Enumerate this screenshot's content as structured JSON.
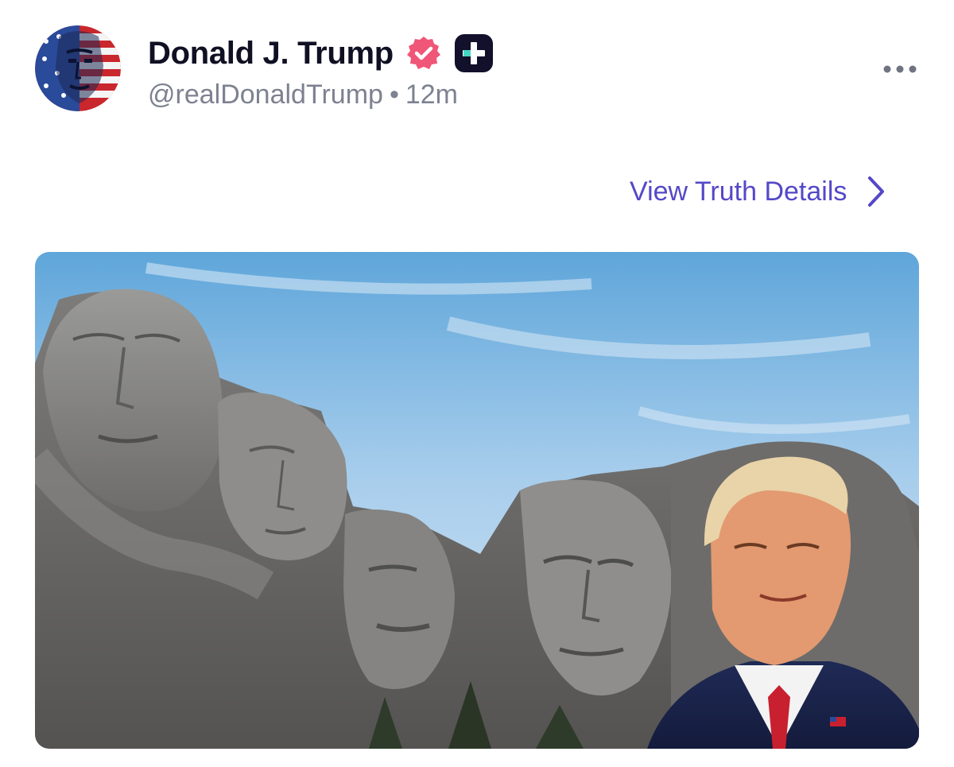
{
  "post": {
    "author": {
      "display_name": "Donald J. Trump",
      "handle": "@realDonaldTrump",
      "avatar_icon": "flag-portrait-avatar",
      "verified_icon": "verified-badge-icon",
      "plus_icon": "plus-badge-icon"
    },
    "separator": "•",
    "timestamp": "12m",
    "more_icon": "more-dots-icon",
    "view_details_label": "View Truth Details",
    "view_details_icon": "chevron-right-icon",
    "media": {
      "type": "image",
      "icon": "mount-rushmore-photo"
    }
  },
  "colors": {
    "verified": "#ef5678",
    "plus_badge": "#12102a",
    "plus_accent": "#43d6c2",
    "link": "#5448c8",
    "meta_text": "#7d8291",
    "name_text": "#101024"
  }
}
